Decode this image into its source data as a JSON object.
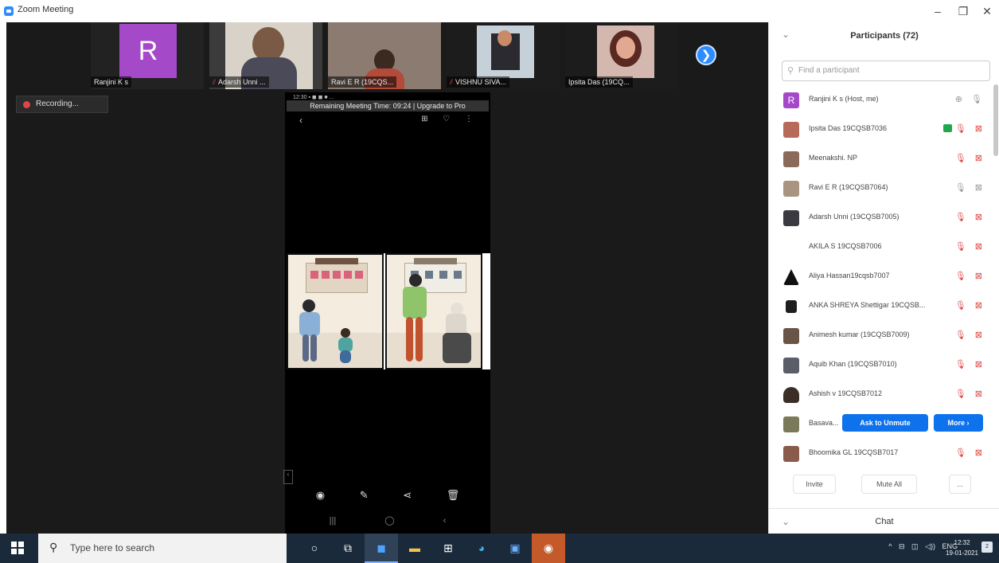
{
  "window": {
    "title": "Zoom Meeting",
    "minimize": "–",
    "maximize": "❐",
    "close": "✕"
  },
  "thumbnails": [
    {
      "name": "Ranjini K s",
      "initial": "R",
      "muted": false
    },
    {
      "name": "Adarsh Unni ...",
      "muted": true
    },
    {
      "name": "Ravi E R (19CQS...",
      "muted": false
    },
    {
      "name": "VISHNU SIVA...",
      "muted": true
    },
    {
      "name": "Ipsita Das (19CQ...",
      "muted": false
    }
  ],
  "thumb_next": "❯",
  "recording": {
    "label": "Recording..."
  },
  "share": {
    "status": "12:30 ▪ ◼ ◼ ■ ...",
    "banner": "Remaining Meeting Time: 09:24 | Upgrade to Pro",
    "back": "‹",
    "tools": "⊞ ♡ ⋮",
    "bottom_nav": "◉ ✎ ⋖ 🗑",
    "system_nav": "||| ◯ ‹",
    "handle": "‹"
  },
  "participants_panel": {
    "title": "Participants (72)",
    "search_placeholder": "Find a participant",
    "participants": [
      {
        "name": "Ranjini K s (Host, me)",
        "avatar": "initial-R",
        "icons": "⊕ 🎙",
        "state": "normal"
      },
      {
        "name": "Ipsita Das 19CQSB7036",
        "avatar": "photo",
        "icons": "🎙 ⊠",
        "state": "video-on"
      },
      {
        "name": "Meenakshi. NP",
        "avatar": "photo",
        "icons": "🎙 ⊠",
        "state": "muted"
      },
      {
        "name": "Ravi E R (19CQSB7064)",
        "avatar": "photo",
        "icons": "🎙 ⊠",
        "state": "normal"
      },
      {
        "name": "Adarsh Unni (19CQSB7005)",
        "avatar": "photo",
        "icons": "🎙 ⊠",
        "state": "muted"
      },
      {
        "name": "AKILA S 19CQSB7006",
        "avatar": "none",
        "icons": "🎙 ⊠",
        "state": "muted"
      },
      {
        "name": "Aliya Hassan19cqsb7007",
        "avatar": "logo",
        "icons": "🎙 ⊠",
        "state": "muted"
      },
      {
        "name": "ANKA SHREYA Shettigar 19CQSB...",
        "avatar": "photo",
        "icons": "🎙 ⊠",
        "state": "muted"
      },
      {
        "name": "Animesh kumar (19CQSB7009)",
        "avatar": "photo",
        "icons": "🎙 ⊠",
        "state": "muted"
      },
      {
        "name": "Aquib Khan (19CQSB7010)",
        "avatar": "photo",
        "icons": "🎙 ⊠",
        "state": "muted"
      },
      {
        "name": "Ashish v 19CQSB7012",
        "avatar": "photo",
        "icons": "🎙 ⊠",
        "state": "muted"
      },
      {
        "name": "Basava...",
        "avatar": "photo",
        "icons": "",
        "state": "hover"
      },
      {
        "name": "Bhoomika GL 19CQSB7017",
        "avatar": "photo",
        "icons": "🎙 ⊠",
        "state": "muted"
      }
    ],
    "ask_to_unmute": "Ask to Unmute",
    "more": "More ›",
    "footer": {
      "invite": "Invite",
      "mute_all": "Mute All",
      "more": "..."
    },
    "chat": "Chat",
    "collapse": "⌄"
  },
  "taskbar": {
    "search_placeholder": "Type here to search",
    "tray": "^ ⊟ ◫ ◁)) ENG",
    "time": "12:32",
    "date": "19-01-2021",
    "notif": "2"
  },
  "colors": {
    "accent": "#0e72ed",
    "muted": "#e04747",
    "avatar_purple": "#a449c7",
    "recording": "#e04545",
    "video_on": "#21a649",
    "taskbar": "#1b2a3a"
  }
}
